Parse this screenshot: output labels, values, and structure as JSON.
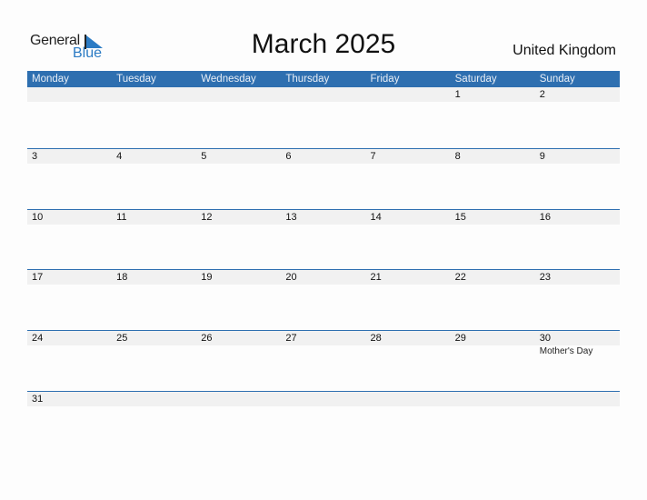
{
  "brand": {
    "word1": "General",
    "word2": "Blue",
    "accent": "#2b7bc4"
  },
  "title": "March 2025",
  "country": "United Kingdom",
  "colors": {
    "header_bg": "#2e6fb0",
    "date_band": "#f1f1f1"
  },
  "weekdays": [
    "Monday",
    "Tuesday",
    "Wednesday",
    "Thursday",
    "Friday",
    "Saturday",
    "Sunday"
  ],
  "weeks": [
    {
      "days": [
        "",
        "",
        "",
        "",
        "",
        "1",
        "2"
      ],
      "holidays": [
        "",
        "",
        "",
        "",
        "",
        "",
        ""
      ]
    },
    {
      "days": [
        "3",
        "4",
        "5",
        "6",
        "7",
        "8",
        "9"
      ],
      "holidays": [
        "",
        "",
        "",
        "",
        "",
        "",
        ""
      ]
    },
    {
      "days": [
        "10",
        "11",
        "12",
        "13",
        "14",
        "15",
        "16"
      ],
      "holidays": [
        "",
        "",
        "",
        "",
        "",
        "",
        ""
      ]
    },
    {
      "days": [
        "17",
        "18",
        "19",
        "20",
        "21",
        "22",
        "23"
      ],
      "holidays": [
        "",
        "",
        "",
        "",
        "",
        "",
        ""
      ]
    },
    {
      "days": [
        "24",
        "25",
        "26",
        "27",
        "28",
        "29",
        "30"
      ],
      "holidays": [
        "",
        "",
        "",
        "",
        "",
        "",
        "Mother's Day"
      ]
    },
    {
      "days": [
        "31",
        "",
        "",
        "",
        "",
        "",
        ""
      ],
      "holidays": [
        "",
        "",
        "",
        "",
        "",
        "",
        ""
      ]
    }
  ]
}
